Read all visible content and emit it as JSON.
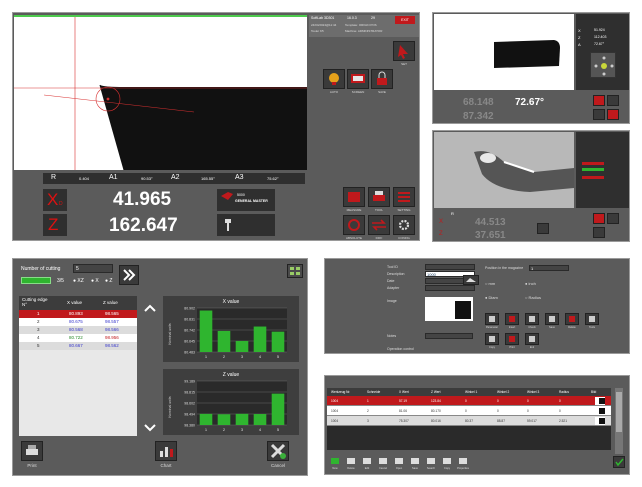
{
  "main": {
    "info": {
      "company": "SoftLab 3D301",
      "version": "16.0.3",
      "number": "29",
      "exit_label": "EXIT",
      "row1_left": "24/04/2024@11:44",
      "row1_mid": "Template: ORIGIN POS",
      "row2_left": "Tooler K5",
      "row2_mid": "Machine: ADMINISTRATOR"
    },
    "readouts": {
      "r_label": "R",
      "r_value": "0.404",
      "a1_label": "A1",
      "a1_value": "90.53°",
      "a2_label": "A2",
      "a2_value": "165.55°",
      "a3_label": "A3",
      "a3_value": "75.62°",
      "x_label": "X",
      "x_sub": "D",
      "x_value": "41.965",
      "z_label": "Z",
      "z_value": "162.647",
      "tool_line1": "5000",
      "tool_line2": "GENERAL MASTER"
    },
    "right_labels": [
      "SET",
      "AUTO",
      "SCREEN",
      "SAVE",
      "TOOL",
      "MODE",
      "ZERO",
      "MENU"
    ],
    "bottom_labels": [
      "MEASURE",
      "TOOL",
      "SETTING",
      "LIST",
      "ABSOLUTE",
      "DIFF",
      "CONFIG"
    ]
  },
  "ui2": {
    "x_val": "68.148",
    "z_val": "87.342",
    "angle": "72.67°",
    "x_side": "51.924",
    "z_side": "112.403",
    "a_side": "72.67°",
    "labels": [
      "X",
      "Z",
      "A"
    ]
  },
  "ui3": {
    "x_val": "44.513",
    "z_val": "37.651",
    "r_label": "R",
    "labels": [
      "X",
      "Z"
    ]
  },
  "cutting": {
    "title": "Number of cutting",
    "count": "5",
    "frac": "3/5",
    "options": [
      "XZ",
      "X",
      "Z"
    ],
    "table_head": [
      "Cutting edge N°",
      "X value",
      "Z value"
    ],
    "rows": [
      [
        "1",
        "80.893",
        "98.565"
      ],
      [
        "2",
        "80.675",
        "98.557"
      ],
      [
        "3",
        "80.568",
        "98.566"
      ],
      [
        "4",
        "80.722",
        "98.956"
      ],
      [
        "5",
        "80.667",
        "98.562"
      ]
    ],
    "footer": [
      "Print",
      "Chart",
      "Cancel"
    ]
  },
  "chart_data": [
    {
      "type": "bar",
      "title": "X value",
      "ylabel": "Nominal units",
      "categories": [
        "1",
        "2",
        "3",
        "4",
        "5"
      ],
      "values": [
        80.893,
        80.675,
        80.568,
        80.722,
        80.667
      ],
      "yticks": [
        "80.902",
        "80.831",
        "80.742",
        "80.645",
        "80.483"
      ],
      "ylim": [
        80.45,
        80.92
      ]
    },
    {
      "type": "bar",
      "title": "Z value",
      "ylabel": "Nominal units",
      "categories": [
        "1",
        "2",
        "3",
        "4",
        "5"
      ],
      "values": [
        98.565,
        98.557,
        98.566,
        98.562,
        98.956
      ],
      "yticks": [
        "99.189",
        "98.815",
        "98.602",
        "98.494",
        "98.380"
      ],
      "ylim": [
        98.35,
        99.2
      ]
    }
  ],
  "form": {
    "labels": [
      "Tool ID",
      "Description",
      "Date",
      "Adapter",
      "Image",
      "",
      "Notes",
      "Operation control"
    ],
    "id_value": "1000",
    "mag_label": "Position in the magazine",
    "mag_value": "1",
    "units": [
      "mm",
      "inch"
    ],
    "modes": [
      "Diam",
      "Radius"
    ],
    "icon_labels": [
      "Parameter",
      "Insert",
      "Check",
      "Save",
      "Delete",
      "Tools",
      "Copy",
      "Print",
      "Exit"
    ]
  },
  "list": {
    "head": [
      "Werkzeug Nr.",
      "Schneide",
      "X Wert",
      "Z Wert",
      "Winkel 1",
      "Winkel 2",
      "Winkel 3",
      "Radius",
      "Bild"
    ],
    "rows": [
      [
        "1004",
        "1",
        "57.19",
        "123.84",
        "0",
        "0",
        "0",
        "0"
      ],
      [
        "1004",
        "2",
        "81.06",
        "80.170",
        "0",
        "0",
        "0",
        "0"
      ],
      [
        "1004",
        "3",
        "75.307",
        "80.016",
        "80.37",
        "88.87",
        "59.017",
        "2.521"
      ]
    ],
    "footer": [
      "New",
      "Delete",
      "Edit",
      "Cancel",
      "Open",
      "Save",
      "Search",
      "Copy",
      "Properties"
    ]
  },
  "colors": {
    "accent_red": "#c0191c",
    "panel": "#5b5b5b",
    "bar_green": "#2fb52f"
  }
}
